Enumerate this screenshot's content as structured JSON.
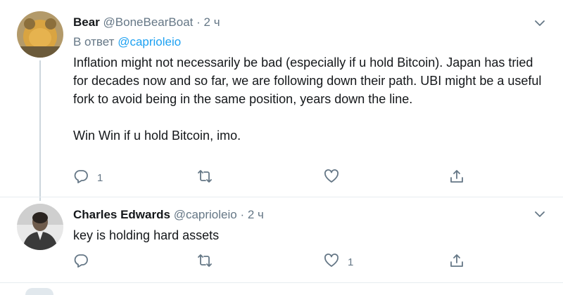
{
  "tweets": [
    {
      "name": "Bear",
      "handle": "@BoneBearBoat",
      "separator": "·",
      "time": "2 ч",
      "reply_prefix": "В ответ",
      "reply_mention": "@caprioleio",
      "paragraphs": [
        "Inflation might not necessarily be bad (especially if u hold Bitcoin). Japan has tried for decades now and so far, we are following down their path. UBI might be a useful fork to avoid being in the same position, years down the line.",
        "Win Win if u hold Bitcoin, imo."
      ],
      "reply_count": "1",
      "retweet_count": "",
      "like_count": "",
      "icons": [
        "avatar",
        "chevron-down-icon",
        "reply-icon",
        "retweet-icon",
        "heart-icon",
        "share-icon"
      ]
    },
    {
      "name": "Charles Edwards",
      "handle": "@caprioleio",
      "separator": "·",
      "time": "2 ч",
      "paragraphs": [
        "key is holding hard assets"
      ],
      "reply_count": "",
      "retweet_count": "",
      "like_count": "1",
      "icons": [
        "avatar",
        "chevron-down-icon",
        "reply-icon",
        "retweet-icon",
        "heart-icon",
        "share-icon"
      ]
    }
  ],
  "colors": {
    "text": "#14171a",
    "secondary": "#657786",
    "link": "#1da1f2",
    "divider": "#e6ecf0",
    "thread_line": "#ccd6dd"
  }
}
